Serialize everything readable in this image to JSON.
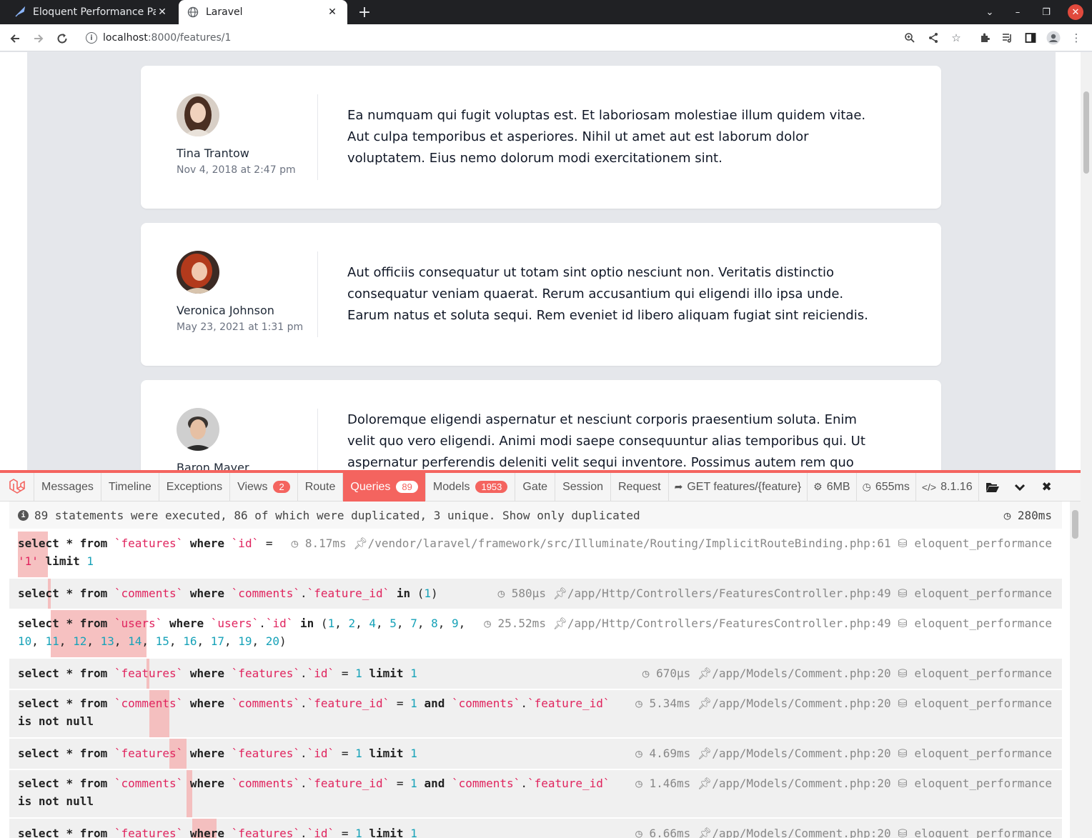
{
  "browser": {
    "tabs": [
      {
        "title": "Eloquent Performance Pa",
        "favicon": "feather-icon"
      },
      {
        "title": "Laravel",
        "favicon": "globe-icon"
      }
    ],
    "url_host": "localhost",
    "url_path": ":8000/features/1"
  },
  "comments": [
    {
      "name": "Tina Trantow",
      "date": "Nov 4, 2018 at 2:47 pm",
      "body": "Ea numquam qui fugit voluptas est. Et laboriosam molestiae illum quidem vitae. Aut culpa temporibus et asperiores. Nihil ut amet aut est laborum dolor voluptatem. Eius nemo dolorum modi exercitationem sint."
    },
    {
      "name": "Veronica Johnson",
      "date": "May 23, 2021 at 1:31 pm",
      "body": "Aut officiis consequatur ut totam sint optio nesciunt non. Veritatis distinctio consequatur veniam quaerat. Rerum accusantium qui eligendi illo ipsa unde. Earum natus et soluta sequi. Rem eveniet id libero aliquam fugiat sint reiciendis."
    },
    {
      "name": "Baron Mayer",
      "date": "",
      "body": "Doloremque eligendi aspernatur et nesciunt corporis praesentium soluta. Enim velit quo vero eligendi. Animi modi saepe consequuntur alias temporibus qui. Ut aspernatur perferendis deleniti velit sequi inventore. Possimus autem rem quo"
    }
  ],
  "debugbar": {
    "tabs": {
      "messages": "Messages",
      "timeline": "Timeline",
      "exceptions": "Exceptions",
      "views": "Views",
      "views_count": "2",
      "route": "Route",
      "queries": "Queries",
      "queries_count": "89",
      "models": "Models",
      "models_count": "1953",
      "gate": "Gate",
      "session": "Session",
      "request": "Request"
    },
    "stats": {
      "route": "GET features/{feature}",
      "memory": "6MB",
      "time": "655ms",
      "php": "8.1.16"
    },
    "summary": "89 statements were executed, 86 of which were duplicated, 3 unique. Show only duplicated",
    "summary_duration": "280ms",
    "queries": [
      {
        "time": "8.17ms",
        "source": "/vendor/laravel/framework/src/Illuminate/Routing/ImplicitRouteBinding.php:61",
        "db": "eloquent_performance"
      },
      {
        "time": "580μs",
        "source": "/app/Http/Controllers/FeaturesController.php:49",
        "db": "eloquent_performance"
      },
      {
        "time": "25.52ms",
        "source": "/app/Http/Controllers/FeaturesController.php:49",
        "db": "eloquent_performance"
      },
      {
        "time": "670μs",
        "source": "/app/Models/Comment.php:20",
        "db": "eloquent_performance"
      },
      {
        "time": "5.34ms",
        "source": "/app/Models/Comment.php:20",
        "db": "eloquent_performance"
      },
      {
        "time": "4.69ms",
        "source": "/app/Models/Comment.php:20",
        "db": "eloquent_performance"
      },
      {
        "time": "1.46ms",
        "source": "/app/Models/Comment.php:20",
        "db": "eloquent_performance"
      },
      {
        "time": "6.66ms",
        "source": "/app/Models/Comment.php:20",
        "db": "eloquent_performance"
      }
    ],
    "sql_fragments": {
      "select": "select",
      "star": "*",
      "from": "from",
      "where": "where",
      "in": "in",
      "and": "and",
      "eq": "=",
      "limit": "limit",
      "is_not_null": "is not null",
      "features": "`features`",
      "comments": "`comments`",
      "users": "`users`",
      "id": "`id`",
      "dot": ".",
      "feature_id": "`feature_id`",
      "one_str": "'1'",
      "one": "1",
      "user_ids_line1": [
        "1",
        "2",
        "4",
        "5",
        "7",
        "8",
        "9"
      ],
      "user_ids_line2": [
        "10",
        "11",
        "12",
        "13",
        "14",
        "15",
        "16",
        "17",
        "19",
        "20"
      ]
    }
  }
}
